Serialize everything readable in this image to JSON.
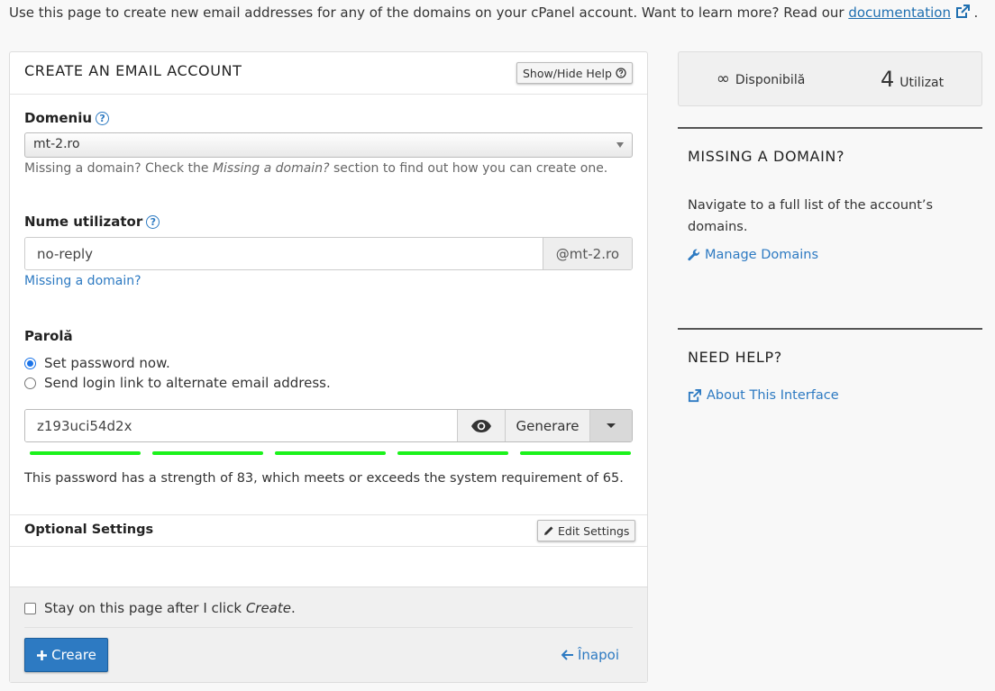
{
  "intro": {
    "text": "Use this page to create new email addresses for any of the domains on your cPanel account. Want to learn more? Read our",
    "link": "documentation",
    "end": "."
  },
  "form": {
    "title": "CREATE AN EMAIL ACCOUNT",
    "help_toggle": "Show/Hide Help",
    "domain": {
      "label": "Domeniu",
      "selected": "mt-2.ro",
      "hint_pre": "Missing a domain? Check the",
      "hint_em": "Missing a domain?",
      "hint_post": "section to find out how you can create one."
    },
    "username": {
      "label": "Nume utilizator",
      "value": "no-reply",
      "suffix": "@mt-2.ro",
      "missing_link": "Missing a domain?"
    },
    "password": {
      "label": "Parolă",
      "option_now": "Set password now.",
      "option_link": "Send login link to alternate email address.",
      "value": "z193uci54d2x",
      "generate": "Generare",
      "strength_message": "This password has a strength of 83, which meets or exceeds the system requirement of 65.",
      "strength_value": 83,
      "strength_required": 65,
      "strength_color": "#1bf21b"
    },
    "optional": {
      "title": "Optional Settings",
      "edit": "Edit Settings"
    },
    "stay": {
      "pre": "Stay on this page after I click",
      "em": "Create",
      "post": "."
    },
    "create": "Creare",
    "back": "Înapoi"
  },
  "stats": {
    "available_value": "∞",
    "available_label": "Disponibilă",
    "used_value": "4",
    "used_label": "Utilizat"
  },
  "sidebar": {
    "missing": {
      "title": "MISSING A DOMAIN?",
      "text": "Navigate to a full list of the account’s domains.",
      "link": "Manage Domains"
    },
    "help": {
      "title": "NEED HELP?",
      "link": "About This Interface"
    }
  },
  "colors": {
    "accent": "#2d7ac2",
    "link": "#1f6fb0",
    "strength": "#1bf21b"
  }
}
